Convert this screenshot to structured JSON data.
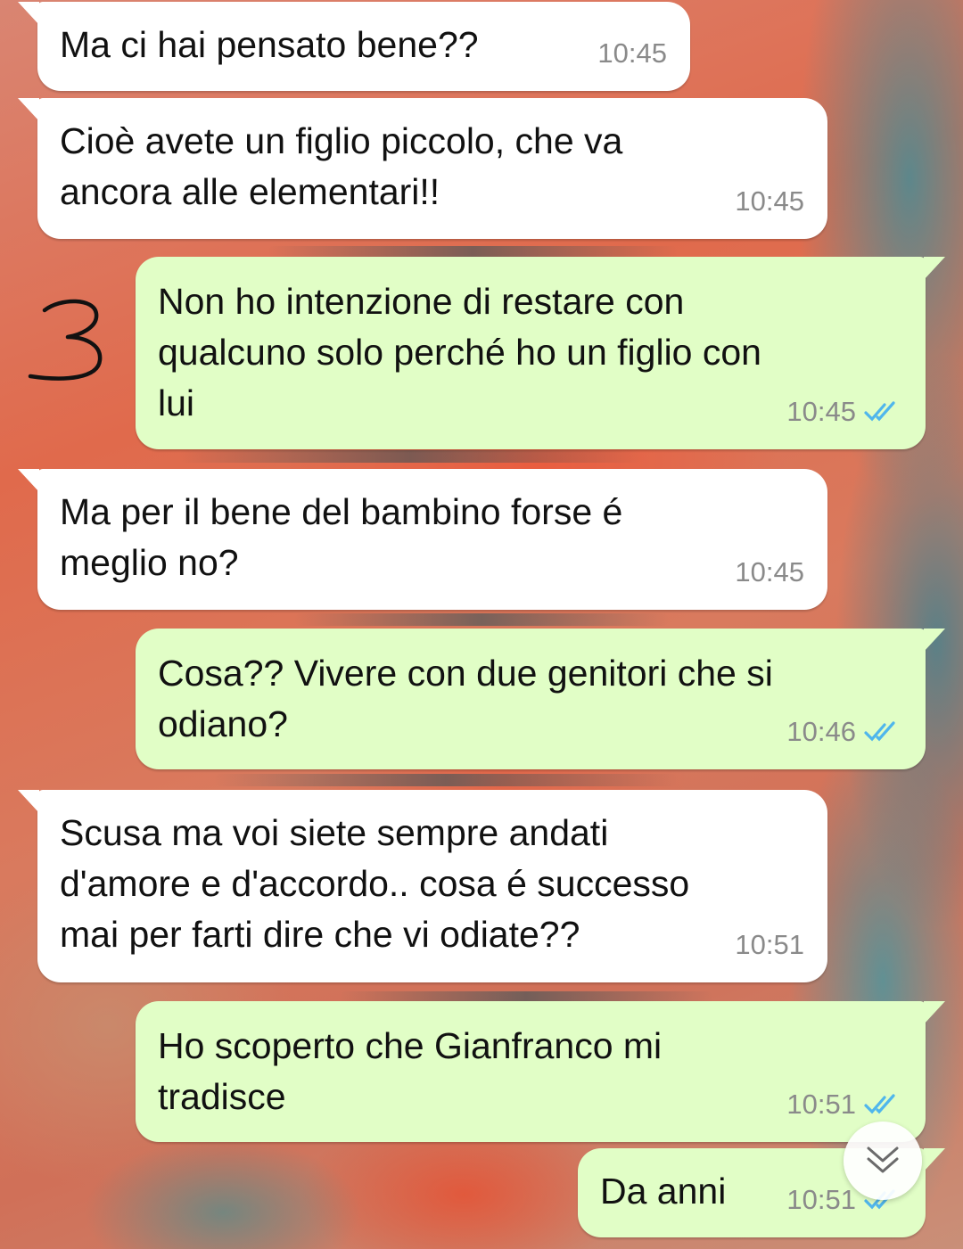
{
  "messages": [
    {
      "direction": "in",
      "text": "Ma ci hai pensato bene??",
      "time": "10:45"
    },
    {
      "direction": "in",
      "text": "Cioè avete un figlio piccolo, che va\nancora alle elementari!!",
      "time": "10:45"
    },
    {
      "direction": "out",
      "text": "Non ho intenzione di restare con\nqualcuno solo perché ho un figlio con\nlui",
      "time": "10:45",
      "status": "read-double-check-icon"
    },
    {
      "direction": "in",
      "text": "Ma per il bene del bambino forse é\nmeglio no?",
      "time": "10:45"
    },
    {
      "direction": "out",
      "text": "Cosa?? Vivere con due genitori che si\nodiano?",
      "time": "10:46",
      "status": "read-double-check-icon"
    },
    {
      "direction": "in",
      "text": "Scusa ma voi siete sempre andati\nd'amore e d'accordo.. cosa é successo\nmai per farti dire che vi odiate??",
      "time": "10:51"
    },
    {
      "direction": "out",
      "text": "Ho scoperto che Gianfranco mi\ntradisce",
      "time": "10:51",
      "status": "read-double-check-icon"
    },
    {
      "direction": "out",
      "text": "Da anni",
      "time": "10:51",
      "status": "read-double-check-icon"
    }
  ],
  "annotation": {
    "icon": "handwritten-number-icon",
    "text": "3"
  },
  "scroll_button": {
    "icon": "double-chevron-down-icon"
  },
  "colors": {
    "incoming_bubble": "#ffffff",
    "outgoing_bubble": "#e1fec6",
    "read_ticks": "#4fb6ec",
    "timestamp": "#8a8a8a"
  }
}
